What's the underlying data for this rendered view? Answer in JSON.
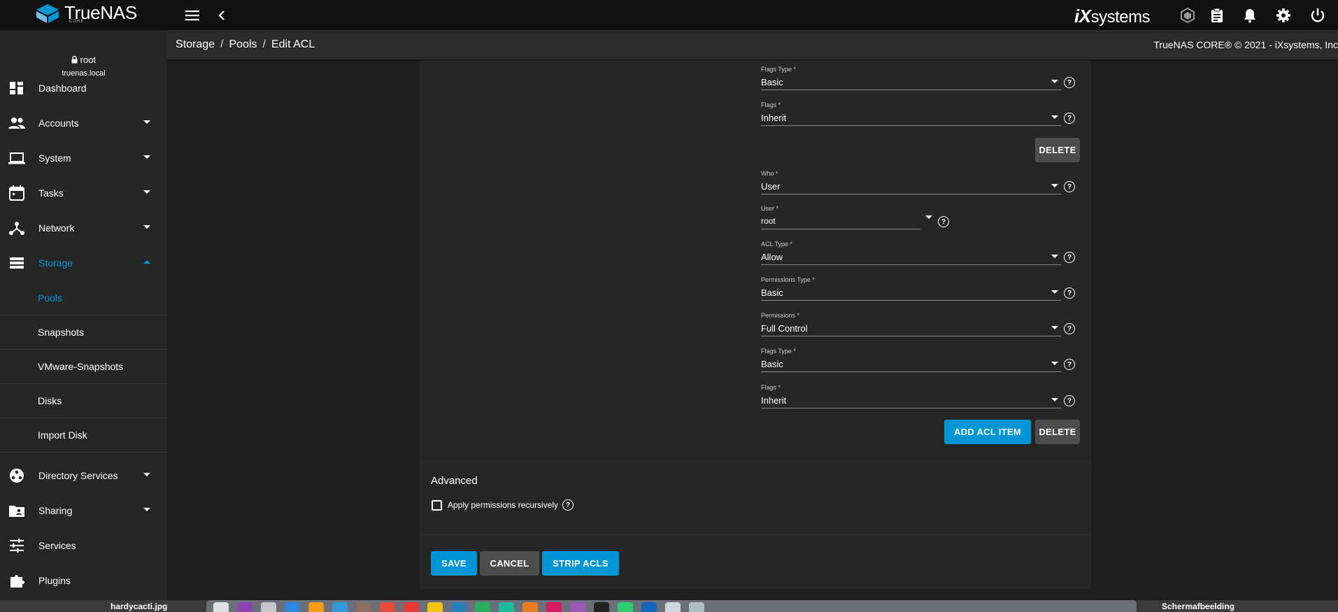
{
  "app": {
    "logo_text": "TrueNAS",
    "logo_sub": "CORE",
    "vendor_logo": "systems",
    "copyright": "TrueNAS CORE® © 2021 - iXsystems, Inc"
  },
  "breadcrumb": {
    "items": [
      "Storage",
      "Pools",
      "Edit ACL"
    ],
    "separator": "/"
  },
  "sidebar": {
    "user": "root",
    "host": "truenas.local",
    "items": [
      {
        "label": "Dashboard",
        "icon": "dashboard-icon"
      },
      {
        "label": "Accounts",
        "icon": "people-icon"
      },
      {
        "label": "System",
        "icon": "laptop-icon"
      },
      {
        "label": "Tasks",
        "icon": "calendar-icon"
      },
      {
        "label": "Network",
        "icon": "network-icon"
      },
      {
        "label": "Storage",
        "icon": "storage-icon"
      },
      {
        "label": "Directory Services",
        "icon": "directory-icon"
      },
      {
        "label": "Sharing",
        "icon": "folder-shared-icon"
      },
      {
        "label": "Services",
        "icon": "tune-icon"
      },
      {
        "label": "Plugins",
        "icon": "puzzle-icon"
      }
    ],
    "storage_sub": [
      "Pools",
      "Snapshots",
      "VMware-Snapshots",
      "Disks",
      "Import Disk"
    ]
  },
  "acl": {
    "entry1": {
      "flags_type_label": "Flags Type *",
      "flags_type_value": "Basic",
      "flags_label": "Flags *",
      "flags_value": "Inherit"
    },
    "entry2": {
      "who_label": "Who *",
      "who_value": "User",
      "user_label": "User *",
      "user_value": "root",
      "acl_type_label": "ACL Type *",
      "acl_type_value": "Allow",
      "perm_type_label": "Permissions Type *",
      "perm_type_value": "Basic",
      "perm_label": "Permissions *",
      "perm_value": "Full Control",
      "flags_type_label": "Flags Type *",
      "flags_type_value": "Basic",
      "flags_label": "Flags *",
      "flags_value": "Inherit"
    },
    "delete_label": "DELETE",
    "add_label": "ADD ACL ITEM"
  },
  "advanced": {
    "title": "Advanced",
    "recursive_label": "Apply permissions recursively",
    "recursive_checked": false
  },
  "actions": {
    "save": "SAVE",
    "cancel": "CANCEL",
    "strip": "STRIP ACLS"
  },
  "dock": {
    "left_file": "hardycacti.jpg",
    "right_label": "Schermafbeelding"
  },
  "colors": {
    "accent": "#0095d5",
    "topbar": "#111111",
    "panel": "#262626",
    "background": "#1e1e1e"
  }
}
